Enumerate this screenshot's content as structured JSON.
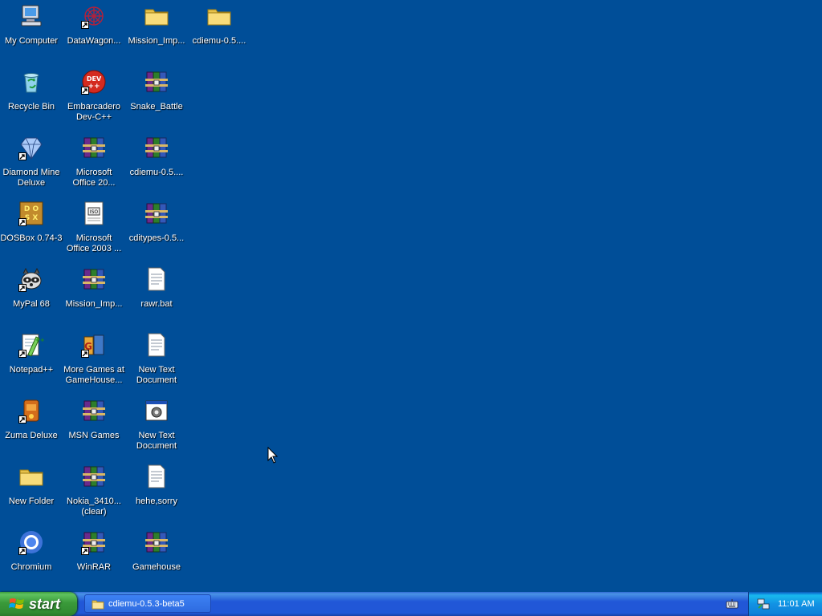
{
  "desktop": {
    "icons": [
      {
        "label": "My Computer",
        "icon": "my-computer-icon",
        "shortcut": false
      },
      {
        "label": "Recycle Bin",
        "icon": "recycle-bin-icon",
        "shortcut": false
      },
      {
        "label": "Diamond Mine\nDeluxe",
        "icon": "diamond-icon",
        "shortcut": true
      },
      {
        "label": "DOSBox 0.74-3",
        "icon": "dosbox-icon",
        "shortcut": true
      },
      {
        "label": "MyPal 68",
        "icon": "raccoon-icon",
        "shortcut": true
      },
      {
        "label": "Notepad++",
        "icon": "notepad-plus-icon",
        "shortcut": true
      },
      {
        "label": "Zuma Deluxe",
        "icon": "zuma-icon",
        "shortcut": true
      },
      {
        "label": "New Folder",
        "icon": "folder-icon",
        "shortcut": false
      },
      {
        "label": "Chromium",
        "icon": "chromium-icon",
        "shortcut": true
      },
      {
        "label": "DataWagon...",
        "icon": "datawagon-icon",
        "shortcut": true
      },
      {
        "label": "Embarcadero\nDev-C++",
        "icon": "devcpp-icon",
        "shortcut": true
      },
      {
        "label": "Microsoft\nOffice 20...",
        "icon": "winrar-archive-icon",
        "shortcut": false
      },
      {
        "label": "Microsoft\nOffice 2003 ...",
        "icon": "disk-image-icon",
        "shortcut": false
      },
      {
        "label": "Mission_Imp...",
        "icon": "winrar-archive-icon",
        "shortcut": false
      },
      {
        "label": "More Games at\nGameHouse...",
        "icon": "gamehouse-icon",
        "shortcut": true
      },
      {
        "label": "MSN Games",
        "icon": "winrar-archive-icon",
        "shortcut": false
      },
      {
        "label": "Nokia_3410...\n(clear)",
        "icon": "winrar-archive-icon",
        "shortcut": false
      },
      {
        "label": "WinRAR",
        "icon": "winrar-archive-icon",
        "shortcut": true
      },
      {
        "label": "Mission_Imp...",
        "icon": "folder-icon",
        "shortcut": false
      },
      {
        "label": "Snake_Battle",
        "icon": "winrar-archive-icon",
        "shortcut": false
      },
      {
        "label": "cdiemu-0.5....",
        "icon": "winrar-archive-icon",
        "shortcut": false
      },
      {
        "label": "cditypes-0.5...",
        "icon": "winrar-archive-icon",
        "shortcut": false
      },
      {
        "label": "rawr.bat",
        "icon": "text-document-icon",
        "shortcut": false
      },
      {
        "label": "New Text\nDocument",
        "icon": "text-document-icon",
        "shortcut": false
      },
      {
        "label": "New Text\nDocument",
        "icon": "program-window-icon",
        "shortcut": false
      },
      {
        "label": "hehe,sorry",
        "icon": "text-document-icon",
        "shortcut": false
      },
      {
        "label": "Gamehouse",
        "icon": "winrar-archive-icon",
        "shortcut": false
      },
      {
        "label": "cdiemu-0.5....",
        "icon": "folder-icon",
        "shortcut": false
      }
    ]
  },
  "taskbar": {
    "start_label": "start",
    "task_button_label": "cdiemu-0.5.3-beta5",
    "clock": "11:01 AM"
  },
  "colors": {
    "desktop_background": "#004e98",
    "taskbar_blue": "#2157d7",
    "start_green": "#3a9a3a",
    "tray_blue": "#1292e4"
  }
}
